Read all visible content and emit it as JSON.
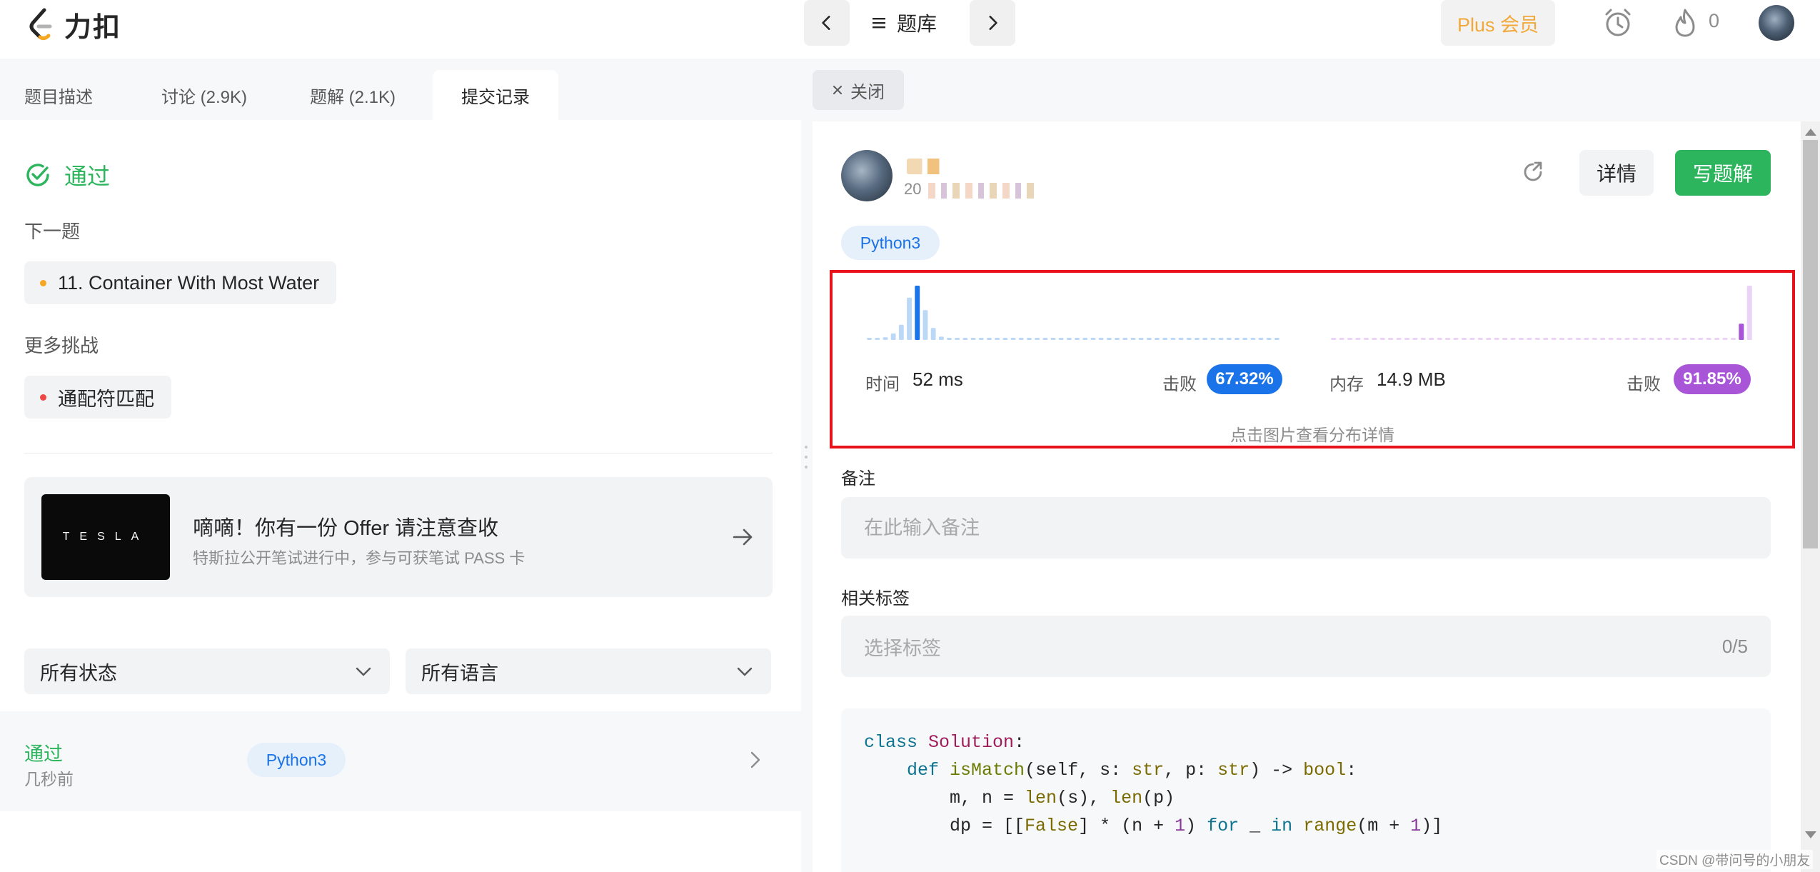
{
  "header": {
    "logo_text": "力扣",
    "problem_bank_label": "题库",
    "plus_label": "Plus 会员",
    "streak_count": "0"
  },
  "left": {
    "tabs": [
      {
        "label": "题目描述"
      },
      {
        "label": "讨论 (2.9K)"
      },
      {
        "label": "题解 (2.1K)"
      },
      {
        "label": "提交记录"
      }
    ],
    "status": "通过",
    "next_label": "下一题",
    "next_problem": "11. Container With Most Water",
    "more_label": "更多挑战",
    "more_problem": "通配符匹配",
    "promo": {
      "image_text": "TESLA",
      "title": "嘀嘀！你有一份 Offer 请注意查收",
      "subtitle": "特斯拉公开笔试进行中，参与可获笔试 PASS 卡"
    },
    "filters": {
      "status": "所有状态",
      "language": "所有语言"
    },
    "submission": {
      "status": "通过",
      "time": "几秒前",
      "language": "Python3"
    }
  },
  "right": {
    "close_label": "关闭",
    "user_time_prefix": "20",
    "detail_label": "详情",
    "write_solution_label": "写题解",
    "language": "Python3",
    "runtime": {
      "label": "时间",
      "value": "52 ms",
      "beat_label": "击败",
      "beat_value": "67.32%"
    },
    "memory": {
      "label": "内存",
      "value": "14.9 MB",
      "beat_label": "击败",
      "beat_value": "91.85%"
    },
    "chart_hint": "点击图片查看分布详情",
    "note_label": "备注",
    "note_placeholder": "在此输入备注",
    "tags_label": "相关标签",
    "tags_placeholder": "选择标签",
    "tags_count": "0/5",
    "code_lines": [
      "class Solution:",
      "    def isMatch(self, s: str, p: str) -> bool:",
      "        m, n = len(s), len(p)",
      "        dp = [[False] * (n + 1) for _ in range(m + 1)]"
    ]
  },
  "watermark": "CSDN @带问号的小朋友",
  "colors": {
    "accept_green": "#2db55d",
    "runtime_blue": "#1a73e8",
    "memory_purple": "#a855d8",
    "highlight_red": "#e8121b",
    "plus_orange": "#f2a93b"
  },
  "chart_data": [
    {
      "type": "bar",
      "name": "",
      "highlight_index": 8,
      "values": [
        0.03,
        0.03,
        0.05,
        0.12,
        0.28,
        0.78,
        1.0,
        0.55,
        0.22,
        0.06,
        0.04,
        0.03,
        0.03,
        0.03,
        0.03,
        0.03,
        0.03,
        0.03,
        0.03,
        0.03,
        0.03,
        0.03,
        0.03,
        0.03,
        0.03,
        0.03,
        0.03,
        0.03,
        0.03,
        0.03,
        0.03,
        0.03,
        0.03,
        0.03,
        0.03,
        0.03,
        0.03,
        0.03,
        0.03,
        0.03,
        0.03,
        0.03,
        0.03,
        0.03,
        0.03,
        0.03,
        0.03,
        0.03,
        0.03,
        0.03,
        0.03,
        0.03
      ],
      "highlight": 6
    },
    {
      "type": "bar",
      "name": "",
      "values": [
        0.03,
        0.03,
        0.03,
        0.03,
        0.03,
        0.03,
        0.03,
        0.03,
        0.03,
        0.03,
        0.03,
        0.03,
        0.03,
        0.03,
        0.03,
        0.03,
        0.03,
        0.03,
        0.03,
        0.03,
        0.03,
        0.03,
        0.03,
        0.03,
        0.03,
        0.03,
        0.03,
        0.03,
        0.03,
        0.03,
        0.03,
        0.03,
        0.03,
        0.03,
        0.03,
        0.03,
        0.03,
        0.03,
        0.03,
        0.03,
        0.03,
        0.03,
        0.03,
        0.03,
        0.03,
        0.03,
        0.03,
        0.03,
        0.03,
        0.03,
        0.3,
        1.0
      ],
      "highlight": 50
    }
  ]
}
